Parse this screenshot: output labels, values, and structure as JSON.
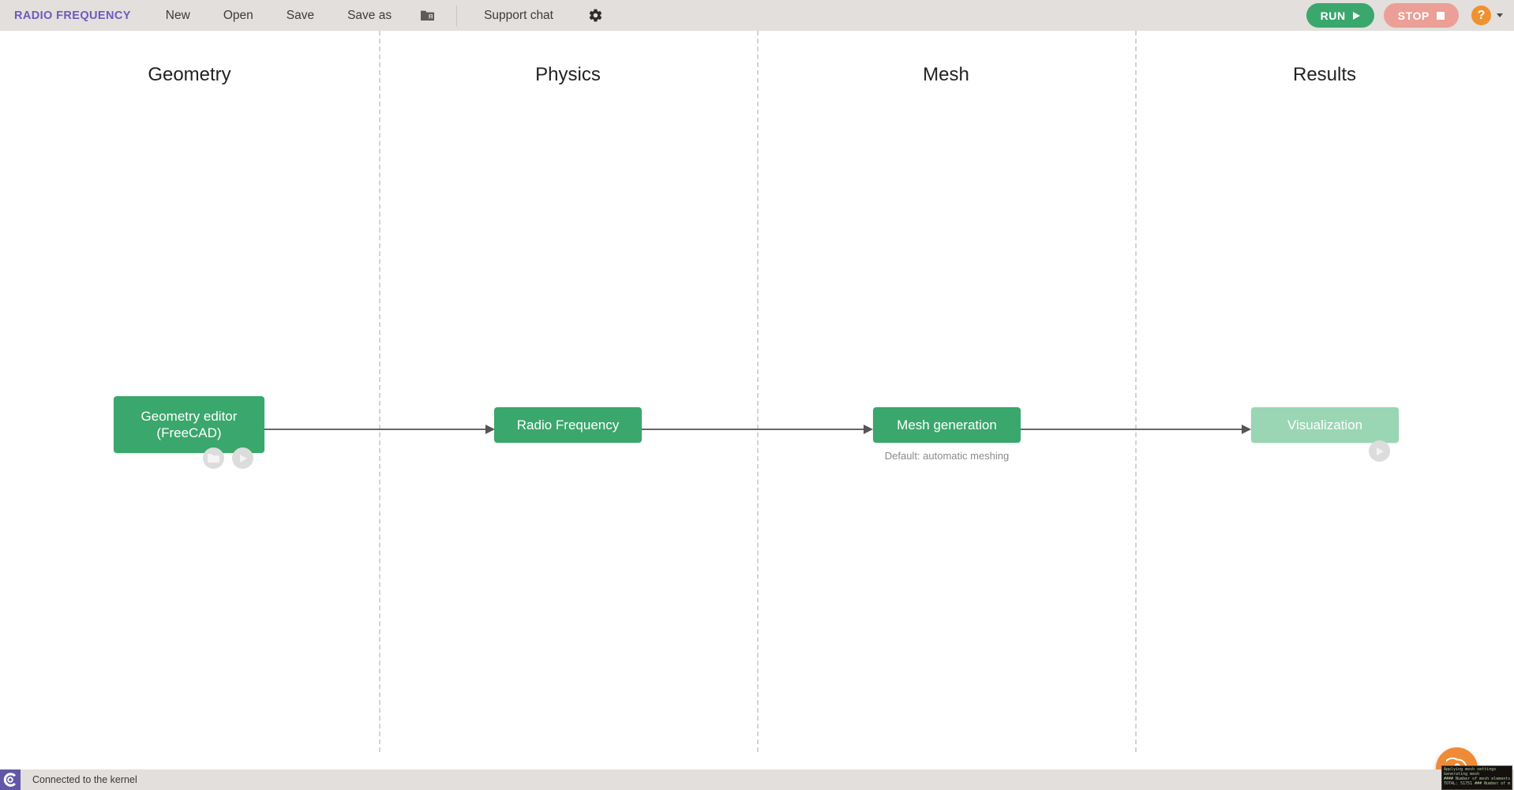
{
  "toolbar": {
    "app_title": "RADIO FREQUENCY",
    "menu": [
      {
        "label": "New"
      },
      {
        "label": "Open"
      },
      {
        "label": "Save"
      },
      {
        "label": "Save as"
      }
    ],
    "folder_icon": "folder-account-icon",
    "support_chat_label": "Support chat",
    "gear_icon": "gear-icon",
    "run_label": "RUN",
    "run_icon": "play-icon",
    "run_color": "#3aa76d",
    "stop_label": "STOP",
    "stop_icon": "stop-square-icon",
    "stop_color": "#eb9f96",
    "help_label": "?",
    "help_color": "#f0912f",
    "help_caret_icon": "chevron-down-icon",
    "background": "#e2dfdc",
    "title_color": "#6b5bbd"
  },
  "workflow": {
    "columns": [
      {
        "title": "Geometry"
      },
      {
        "title": "Physics"
      },
      {
        "title": "Mesh"
      },
      {
        "title": "Results"
      }
    ],
    "nodes": [
      {
        "id": "geometry-editor",
        "label": "Geometry editor\n(FreeCAD)",
        "state": "active",
        "color": "#3aa76d",
        "buttons": [
          {
            "name": "open-folder-button",
            "icon": "folder-icon"
          },
          {
            "name": "run-node-button",
            "icon": "play-icon"
          }
        ]
      },
      {
        "id": "radio-frequency",
        "label": "Radio Frequency",
        "state": "active",
        "color": "#3aa76d",
        "buttons": []
      },
      {
        "id": "mesh-generation",
        "label": "Mesh generation",
        "state": "active",
        "color": "#3aa76d",
        "caption": "Default: automatic meshing",
        "buttons": []
      },
      {
        "id": "visualization",
        "label": "Visualization",
        "state": "disabled",
        "color": "#9ad6b4",
        "buttons": [
          {
            "name": "run-node-button",
            "icon": "play-icon"
          }
        ]
      }
    ]
  },
  "support_fab": {
    "icon": "help-chat-icon",
    "color": "#ef8b36"
  },
  "statusbar": {
    "kernel_logo": "kernel-logo-icon",
    "kernel_status": "Connected to the kernel",
    "background": "#e2dfdc"
  },
  "log_panel": {
    "lines": [
      "Applying mesh settings",
      "Generating mesh",
      "#### Number of mesh elements",
      "TOTAL: 51751 ### Number of m"
    ]
  }
}
